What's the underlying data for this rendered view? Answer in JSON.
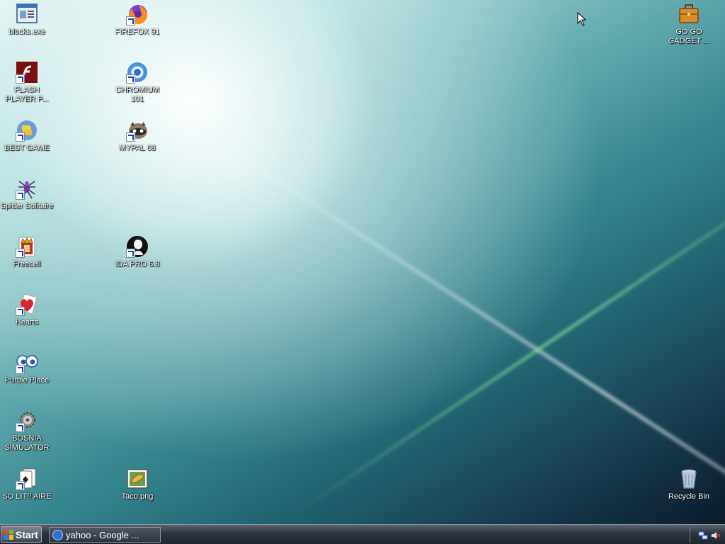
{
  "desktop": {
    "icons": [
      {
        "id": "blocks",
        "label": "blocks.exe",
        "icon": "window-app-icon"
      },
      {
        "id": "firefox",
        "label": "FIREFOX 91",
        "icon": "firefox-icon"
      },
      {
        "id": "gadget",
        "label": "GO GO GADGET ...",
        "icon": "briefcase-icon"
      },
      {
        "id": "flash",
        "label": "FLASH PLAYER P...",
        "icon": "flash-icon"
      },
      {
        "id": "chromium",
        "label": "CHROMIUM 101",
        "icon": "chromium-icon"
      },
      {
        "id": "bestgame",
        "label": "BEST GAME",
        "icon": "python-icon"
      },
      {
        "id": "mypal",
        "label": "MYPAL 68",
        "icon": "raccoon-icon"
      },
      {
        "id": "spider",
        "label": "Spider Solitaire",
        "icon": "spider-icon"
      },
      {
        "id": "freecell",
        "label": "Freecell",
        "icon": "king-card-icon"
      },
      {
        "id": "idapro",
        "label": "IDA PRO 6.8",
        "icon": "ida-icon"
      },
      {
        "id": "hearts",
        "label": "Hearts",
        "icon": "hearts-icon"
      },
      {
        "id": "purble",
        "label": "Purble Place",
        "icon": "eyes-icon"
      },
      {
        "id": "bosnia",
        "label": "BOSNIA SIMULATOR",
        "icon": "gear-icon"
      },
      {
        "id": "solitaire",
        "label": "SO LIT!! AIRE",
        "icon": "cards-icon"
      },
      {
        "id": "taco",
        "label": "Taco.png",
        "icon": "image-file-icon"
      },
      {
        "id": "recycle",
        "label": "Recycle Bin",
        "icon": "recycle-bin-icon"
      }
    ]
  },
  "taskbar": {
    "start_label": "Start",
    "task_label": "yahoo - Google ...",
    "tray_icons": [
      "network-icon",
      "volume-muted-icon"
    ]
  },
  "colors": {
    "taskbar": "#2b333c",
    "desktop_light": "#e8f6f6",
    "desktop_dark": "#0c1a2a"
  }
}
